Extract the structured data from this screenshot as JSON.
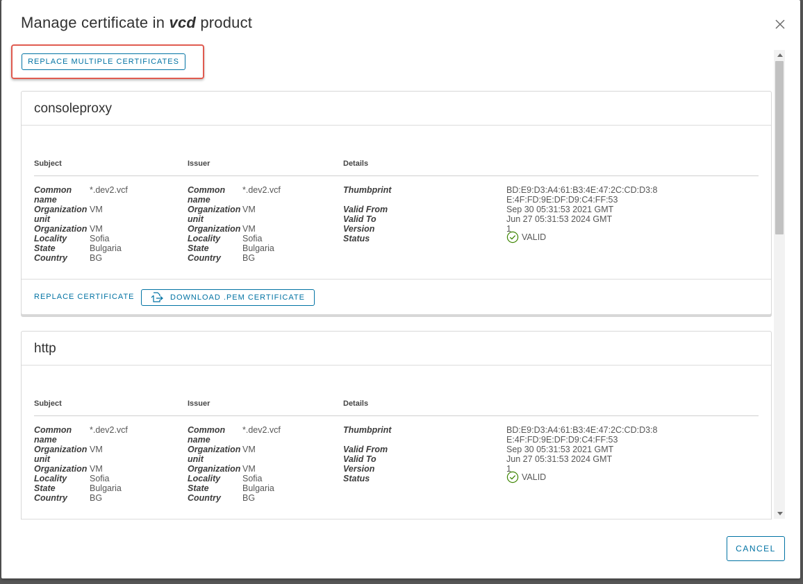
{
  "dialog": {
    "title_prefix": "Manage certificate in",
    "title_product": "vcd",
    "title_suffix": "product",
    "replace_multiple_label": "REPLACE MULTIPLE CERTIFICATES",
    "cancel_label": "CANCEL"
  },
  "labels": {
    "subject": "Subject",
    "issuer": "Issuer",
    "details": "Details",
    "common_name_1": "Common",
    "common_name_2": "name",
    "org_unit_1": "Organization",
    "org_unit_2": "unit",
    "organization": "Organization",
    "locality": "Locality",
    "state": "State",
    "country": "Country",
    "thumbprint": "Thumbprint",
    "valid_from": "Valid From",
    "valid_to": "Valid To",
    "version": "Version",
    "status": "Status",
    "replace_certificate": "REPLACE CERTIFICATE",
    "download_pem": "DOWNLOAD .PEM CERTIFICATE"
  },
  "certificates": [
    {
      "name": "consoleproxy",
      "subject": {
        "common_name": "*.dev2.vcf",
        "org_unit": "VM",
        "organization": "VM",
        "locality": "Sofia",
        "state": "Bulgaria",
        "country": "BG"
      },
      "issuer": {
        "common_name": "*.dev2.vcf",
        "org_unit": "VM",
        "organization": "VM",
        "locality": "Sofia",
        "state": "Bulgaria",
        "country": "BG"
      },
      "details": {
        "thumbprint_1": "BD:E9:D3:A4:61:B3:4E:47:2C:CD:D3:8",
        "thumbprint_2": "E:4F:FD:9E:DF:D9:C4:FF:53",
        "valid_from": "Sep 30 05:31:53 2021 GMT",
        "valid_to": "Jun 27 05:31:53 2024 GMT",
        "version": "1",
        "status": "VALID"
      }
    },
    {
      "name": "http",
      "subject": {
        "common_name": "*.dev2.vcf",
        "org_unit": "VM",
        "organization": "VM",
        "locality": "Sofia",
        "state": "Bulgaria",
        "country": "BG"
      },
      "issuer": {
        "common_name": "*.dev2.vcf",
        "org_unit": "VM",
        "organization": "VM",
        "locality": "Sofia",
        "state": "Bulgaria",
        "country": "BG"
      },
      "details": {
        "thumbprint_1": "BD:E9:D3:A4:61:B3:4E:47:2C:CD:D3:8",
        "thumbprint_2": "E:4F:FD:9E:DF:D9:C4:FF:53",
        "valid_from": "Sep 30 05:31:53 2021 GMT",
        "valid_to": "Jun 27 05:31:53 2024 GMT",
        "version": "1",
        "status": "VALID"
      }
    }
  ],
  "colors": {
    "accent": "#0072a3",
    "valid": "#3c8500",
    "highlight": "#e05a4f"
  }
}
